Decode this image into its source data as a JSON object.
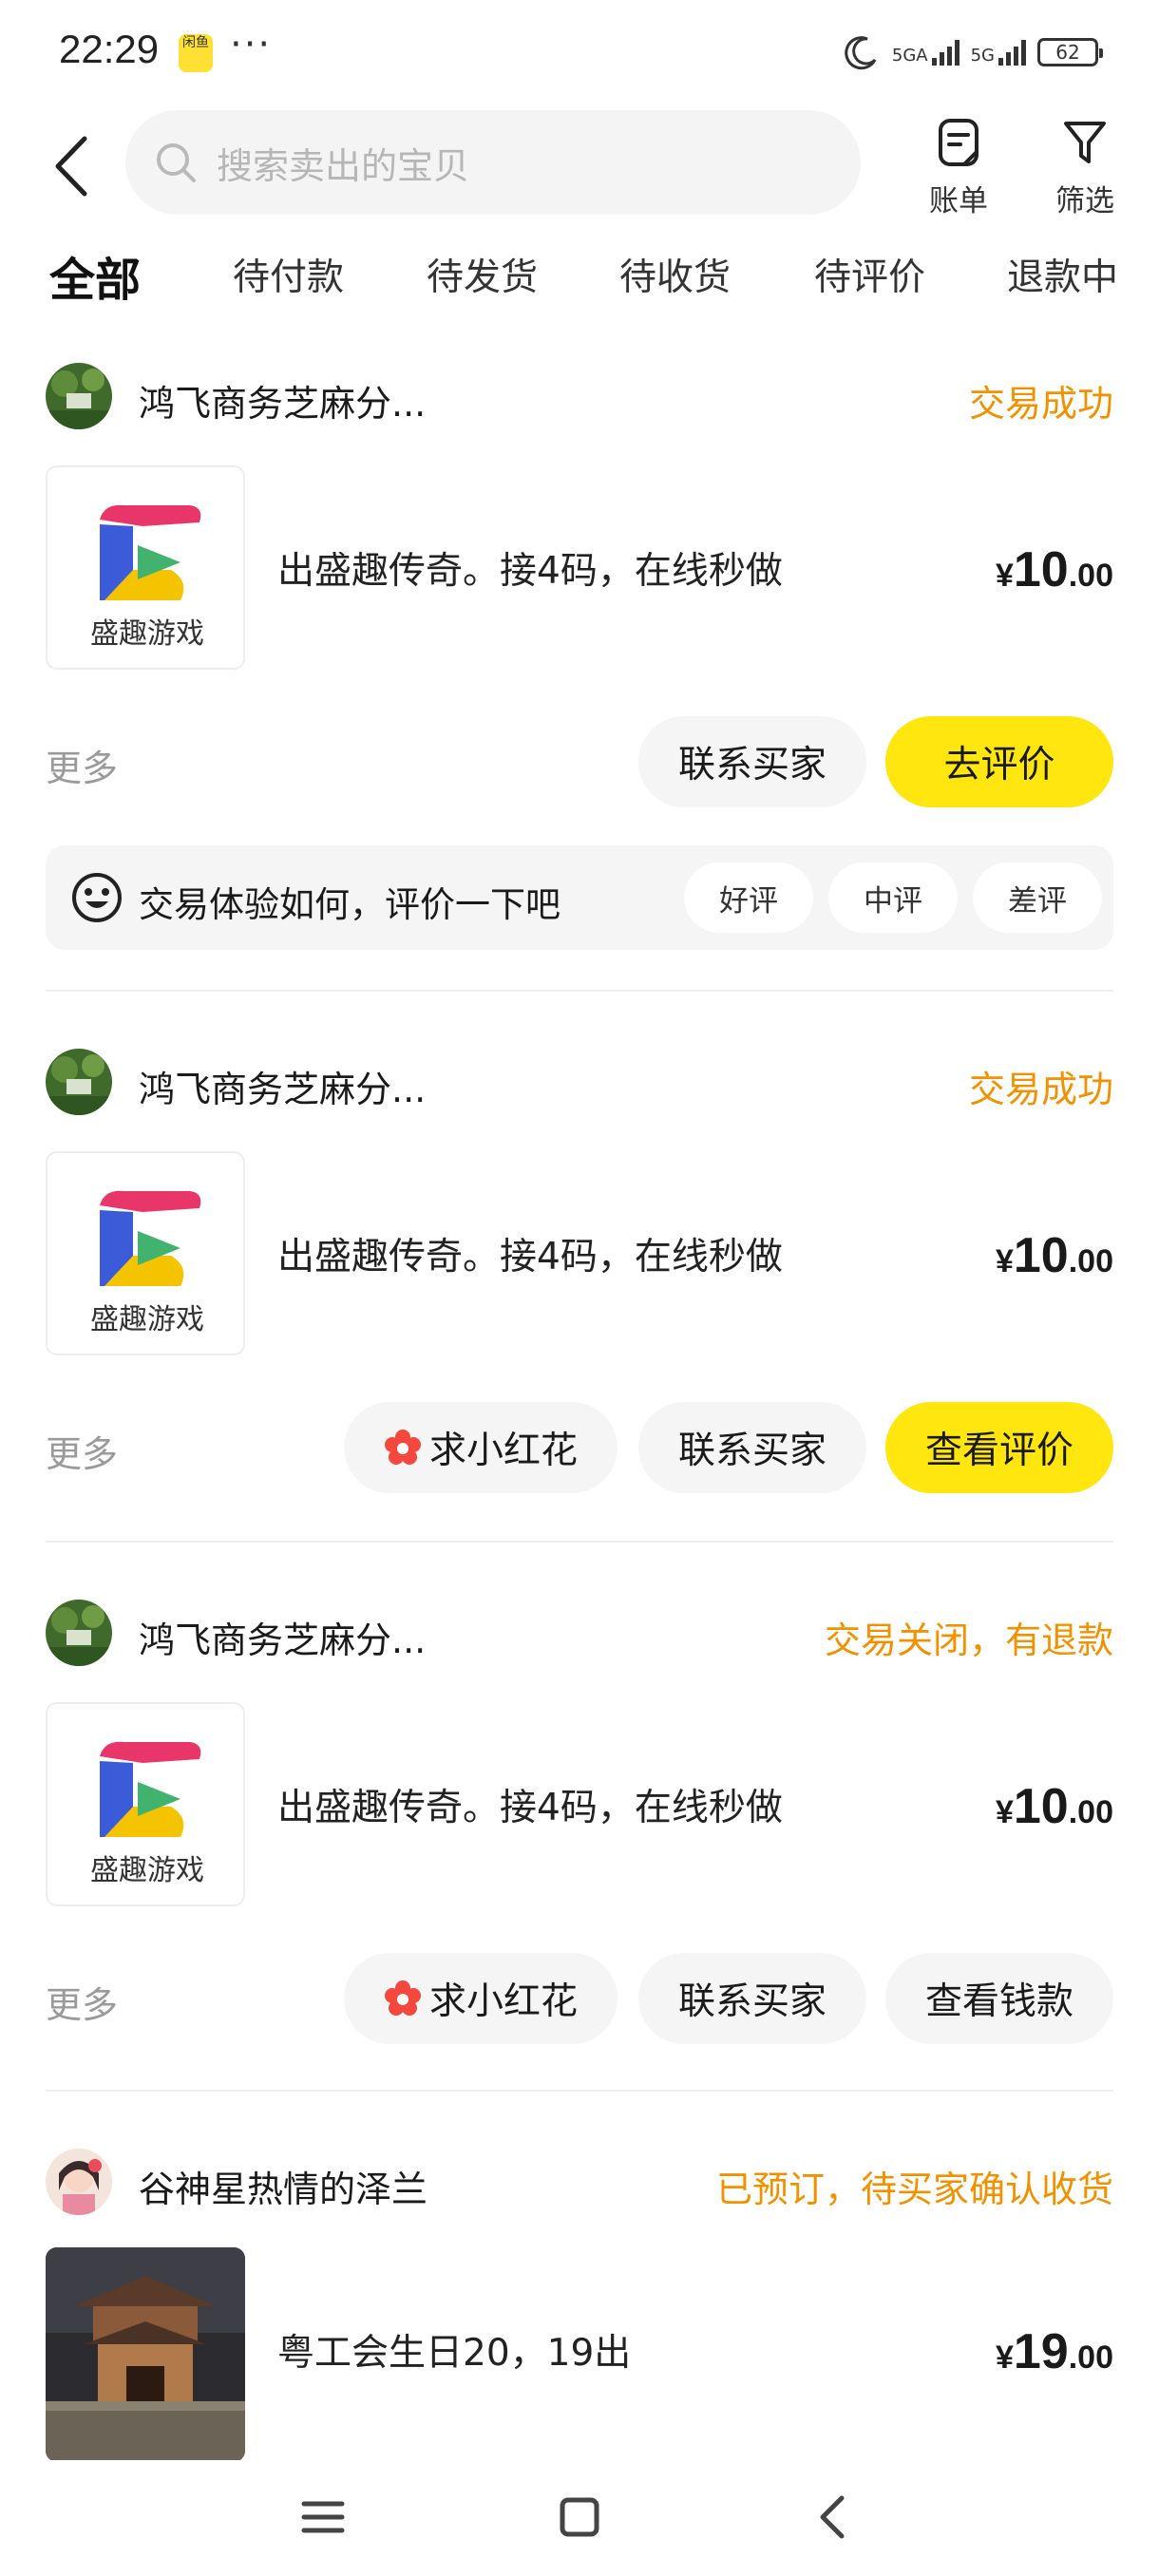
{
  "status_bar": {
    "time": "22:29",
    "app_badge": "闲鱼",
    "more_dots": "···",
    "signal_1": "5GA",
    "signal_2": "5G",
    "battery": "62"
  },
  "header": {
    "search_placeholder": "搜索卖出的宝贝",
    "bill_label": "账单",
    "filter_label": "筛选"
  },
  "tabs": [
    {
      "label": "全部",
      "active": true
    },
    {
      "label": "待付款"
    },
    {
      "label": "待发货"
    },
    {
      "label": "待收货"
    },
    {
      "label": "待评价"
    },
    {
      "label": "退款中"
    }
  ],
  "orders": [
    {
      "shop": "鸿飞商务芝麻分...",
      "status": "交易成功",
      "title": "出盛趣传奇。接4码，在线秒做",
      "thumb_text": "盛趣游戏",
      "price_cur": "¥",
      "price_int": "10",
      "price_dec": ".00",
      "more": "更多",
      "buttons": [
        "联系买家",
        "去评价"
      ],
      "rating": {
        "prompt": "交易体验如何，评价一下吧",
        "options": [
          "好评",
          "中评",
          "差评"
        ]
      }
    },
    {
      "shop": "鸿飞商务芝麻分...",
      "status": "交易成功",
      "title": "出盛趣传奇。接4码，在线秒做",
      "thumb_text": "盛趣游戏",
      "price_cur": "¥",
      "price_int": "10",
      "price_dec": ".00",
      "more": "更多",
      "buttons": [
        "求小红花",
        "联系买家",
        "查看评价"
      ]
    },
    {
      "shop": "鸿飞商务芝麻分...",
      "status": "交易关闭，有退款",
      "title": "出盛趣传奇。接4码，在线秒做",
      "thumb_text": "盛趣游戏",
      "price_cur": "¥",
      "price_int": "10",
      "price_dec": ".00",
      "more": "更多",
      "buttons": [
        "求小红花",
        "联系买家",
        "查看钱款"
      ]
    },
    {
      "shop": "谷神星热情的泽兰",
      "status": "已预订，待买家确认收货",
      "title": "粤工会生日20，19出",
      "price_cur": "¥",
      "price_int": "19",
      "price_dec": ".00"
    }
  ],
  "colors": {
    "accent_yellow": "#ffe60f",
    "status_orange": "#f29100",
    "muted_gray": "#9a9a9a"
  },
  "icons": [
    "back-icon",
    "search-icon",
    "bill-icon",
    "filter-icon",
    "face-emoji-icon",
    "flower-icon",
    "menu-icon",
    "home-icon",
    "nav-back-icon"
  ]
}
